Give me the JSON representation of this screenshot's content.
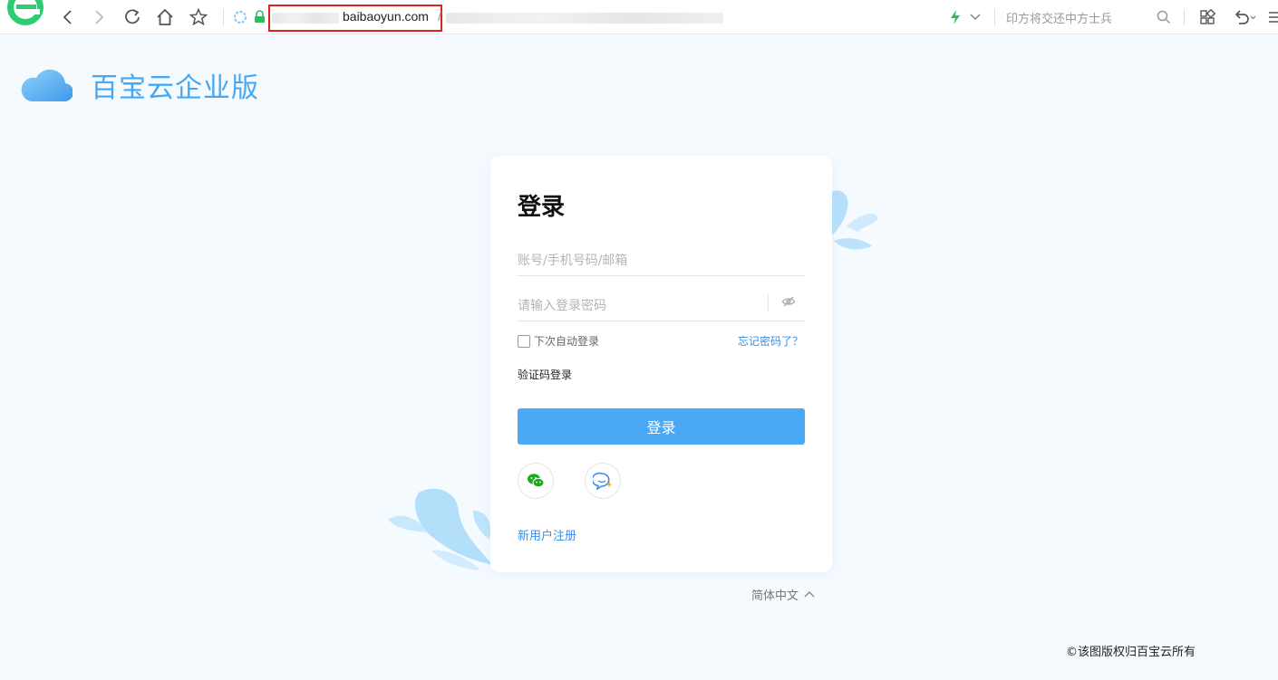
{
  "browser": {
    "url_domain": "baibaoyun.com",
    "url_trailing": "/",
    "search_placeholder": "印方将交还中方士兵",
    "icons": [
      "browser-logo-icon",
      "back-icon",
      "forward-icon",
      "reload-icon",
      "home-icon",
      "star-icon",
      "shield-icon",
      "lock-icon",
      "lightning-icon",
      "chevron-down-icon",
      "search-icon",
      "apps-icon",
      "undo-icon",
      "menu-icon"
    ]
  },
  "brand": {
    "name": "百宝云企业版"
  },
  "login": {
    "title": "登录",
    "account_placeholder": "账号/手机号码/邮箱",
    "password_placeholder": "请输入登录密码",
    "remember_label": "下次自动登录",
    "forgot_link": "忘记密码了？",
    "code_login": "验证码登录",
    "submit": "登录",
    "register": "新用户注册"
  },
  "footer": {
    "language": "简体中文",
    "copyright": "©该图版权归百宝云所有"
  },
  "colors": {
    "accent": "#4aa8f7",
    "link": "#3a8ee6",
    "highlight": "#e02020",
    "page_bg": "#f5faff"
  }
}
